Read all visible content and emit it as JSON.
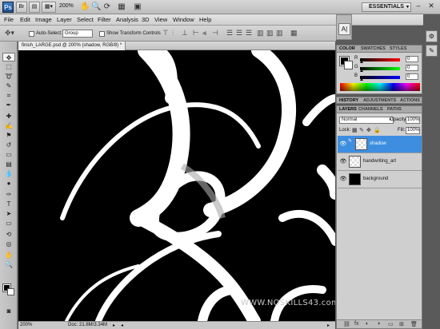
{
  "appbar": {
    "logo": "Ps",
    "zoom": "200%",
    "workspace": "ESSENTIALS",
    "minimize": "–",
    "close": "✕"
  },
  "menu": [
    "File",
    "Edit",
    "Image",
    "Layer",
    "Select",
    "Filter",
    "Analysis",
    "3D",
    "View",
    "Window",
    "Help"
  ],
  "options": {
    "auto_select_label": "Auto-Select:",
    "auto_select_value": "Group",
    "show_transform_label": "Show Transform Controls"
  },
  "mini_panel": {
    "icon": "A|"
  },
  "document": {
    "tab_title": "finish_LARGE.psd @ 200% (shadow, RGB/8) *",
    "watermark": "WWW.NOSKILLS43.com",
    "status_zoom": "200%",
    "status_doc": "Doc: 21.8M/3.34M"
  },
  "color_panel": {
    "tabs": [
      "COLOR",
      "SWATCHES",
      "STYLES"
    ],
    "r_label": "R",
    "g_label": "G",
    "b_label": "B",
    "r_value": "0",
    "g_value": "0",
    "b_value": "0"
  },
  "history_panel": {
    "tabs": [
      "HISTORY",
      "ADJUSTMENTS",
      "ACTIONS"
    ]
  },
  "layers_panel": {
    "tabs": [
      "LAYERS",
      "CHANNELS",
      "PATHS"
    ],
    "blend_mode": "Normal",
    "opacity_label": "Opacity:",
    "opacity_value": "100%",
    "lock_label": "Lock:",
    "fill_label": "Fill:",
    "fill_value": "100%",
    "layers": [
      {
        "name": "shadow",
        "selected": true
      },
      {
        "name": "handwriting_art",
        "selected": false
      },
      {
        "name": "background",
        "selected": false
      }
    ]
  }
}
